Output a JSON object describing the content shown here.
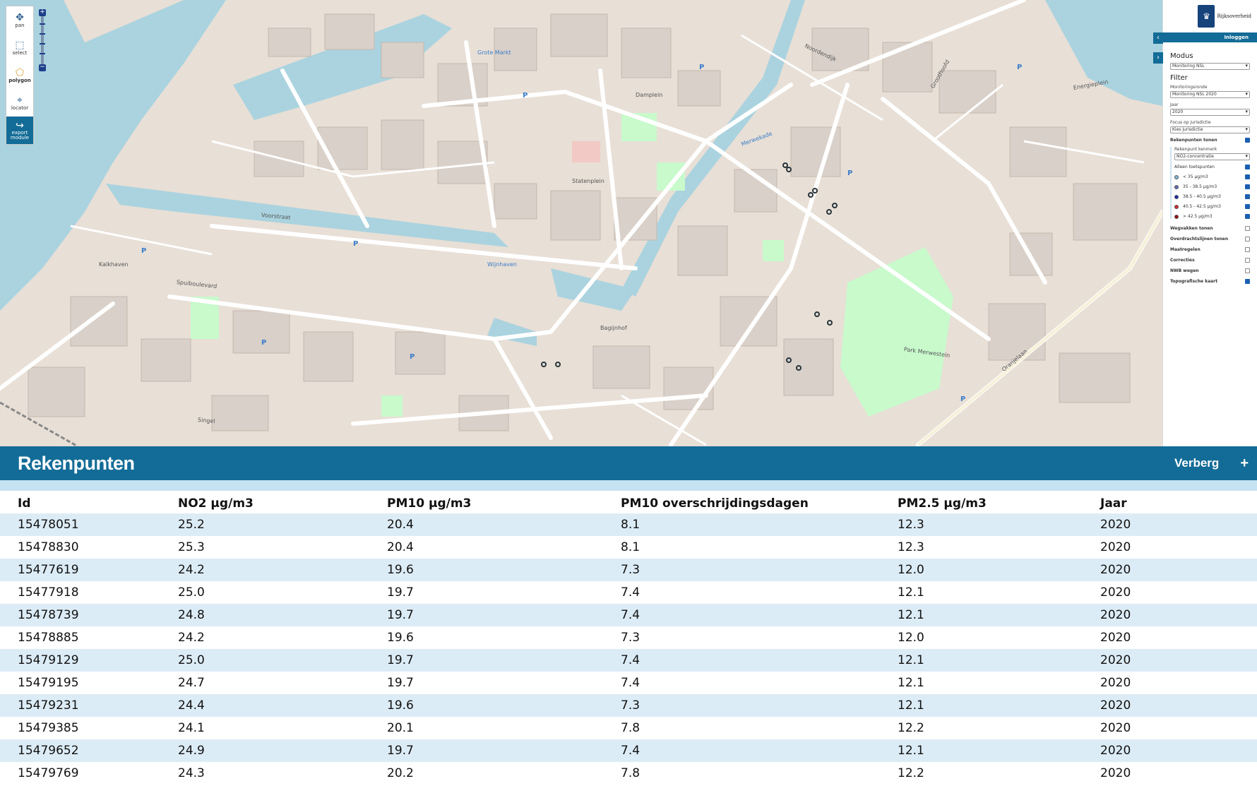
{
  "tools": [
    {
      "label": "pan",
      "icon": "move-icon"
    },
    {
      "label": "select",
      "icon": "select-icon"
    },
    {
      "label": "polygon",
      "icon": "polygon-icon"
    },
    {
      "label": "locator",
      "icon": "locator-icon"
    },
    {
      "label": "export\nmodule",
      "icon": "export-icon"
    }
  ],
  "map": {
    "labels": [
      {
        "text": "Spuiboulevard",
        "blue": false
      },
      {
        "text": "Noordendijk",
        "blue": false
      },
      {
        "text": "Merwekade",
        "blue": true
      },
      {
        "text": "Wijnhaven",
        "blue": true
      },
      {
        "text": "Voorstraat",
        "blue": false
      },
      {
        "text": "Statenplein",
        "blue": false
      },
      {
        "text": "Park Merwestein",
        "blue": false
      },
      {
        "text": "Groothoofd",
        "blue": false
      },
      {
        "text": "Energieplein",
        "blue": false
      },
      {
        "text": "Oranjelaan",
        "blue": false
      },
      {
        "text": "Singel",
        "blue": false
      },
      {
        "text": "Grote Markt",
        "blue": true
      },
      {
        "text": "Kalkhaven",
        "blue": false
      },
      {
        "text": "Damplein",
        "blue": false
      },
      {
        "text": "Bagijnhof",
        "blue": false
      }
    ]
  },
  "panel": {
    "brand": "Rijksoverheid",
    "login": "Inloggen",
    "modus_title": "Modus",
    "modus_value": "Monitoring NSL",
    "filter_title": "Filter",
    "ronde_label": "Monitoringsronde",
    "ronde_value": "Monitoring NSL 2020",
    "jaar_label": "Jaar",
    "jaar_value": "2020",
    "focus_label": "Focus op jurisdictie",
    "focus_value": "Kies jurisdictie",
    "rekenpunten_label": "Rekenpunten tonen",
    "kenmerk_label": "Rekenpunt kenmerk",
    "kenmerk_value": "NO2-concentratie",
    "toets_label": "Alleen toetspunten",
    "legend": [
      {
        "label": "< 35 µg/m3",
        "color": "#7fb7d9"
      },
      {
        "label": "35 - 38.5 µg/m3",
        "color": "#5b6fb5"
      },
      {
        "label": "38.5 - 40.5 µg/m3",
        "color": "#1a2cb0"
      },
      {
        "label": "40.5 - 42.5 µg/m3",
        "color": "#d6262b"
      },
      {
        "label": "> 42.5 µg/m3",
        "color": "#9b0f14"
      }
    ],
    "layers": [
      {
        "label": "Wegvakken tonen",
        "checked": false
      },
      {
        "label": "Overdrachtslijnen tonen",
        "checked": false
      },
      {
        "label": "Maatregelen",
        "checked": false
      },
      {
        "label": "Correcties",
        "checked": false
      },
      {
        "label": "NWB wegen",
        "checked": false
      },
      {
        "label": "Topografische kaart",
        "checked": true
      }
    ]
  },
  "bottom": {
    "title": "Rekenpunten",
    "hide_label": "Verberg",
    "plus_label": "+"
  },
  "table": {
    "columns": [
      "Id",
      "NO2 µg/m3",
      "PM10 µg/m3",
      "PM10 overschrijdingsdagen",
      "PM2.5 µg/m3",
      "Jaar"
    ],
    "rows": [
      [
        "15478051",
        "25.2",
        "20.4",
        "8.1",
        "12.3",
        "2020"
      ],
      [
        "15478830",
        "25.3",
        "20.4",
        "8.1",
        "12.3",
        "2020"
      ],
      [
        "15477619",
        "24.2",
        "19.6",
        "7.3",
        "12.0",
        "2020"
      ],
      [
        "15477918",
        "25.0",
        "19.7",
        "7.4",
        "12.1",
        "2020"
      ],
      [
        "15478739",
        "24.8",
        "19.7",
        "7.4",
        "12.1",
        "2020"
      ],
      [
        "15478885",
        "24.2",
        "19.6",
        "7.3",
        "12.0",
        "2020"
      ],
      [
        "15479129",
        "25.0",
        "19.7",
        "7.4",
        "12.1",
        "2020"
      ],
      [
        "15479195",
        "24.7",
        "19.7",
        "7.4",
        "12.1",
        "2020"
      ],
      [
        "15479231",
        "24.4",
        "19.6",
        "7.3",
        "12.1",
        "2020"
      ],
      [
        "15479385",
        "24.1",
        "20.1",
        "7.8",
        "12.2",
        "2020"
      ],
      [
        "15479652",
        "24.9",
        "19.7",
        "7.4",
        "12.1",
        "2020"
      ],
      [
        "15479769",
        "24.3",
        "20.2",
        "7.8",
        "12.2",
        "2020"
      ]
    ]
  }
}
